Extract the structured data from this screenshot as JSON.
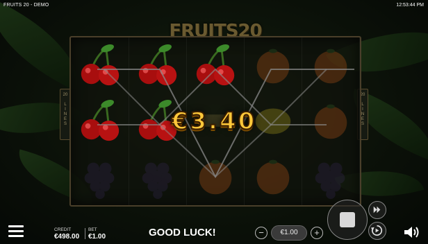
{
  "topbar": {
    "title": "FRUITS 20 - DEMO",
    "clock": "12:53:44 PM"
  },
  "logo": {
    "text": "FRUITS20"
  },
  "lines_badge": {
    "count": "20",
    "label": "LINES"
  },
  "reels": [
    [
      "cherry",
      "cherry",
      "grapes"
    ],
    [
      "cherry",
      "cherry",
      "grapes"
    ],
    [
      "cherry",
      "bar",
      "orange"
    ],
    [
      "orange",
      "lemon",
      "orange"
    ],
    [
      "orange",
      "orange",
      "grapes"
    ]
  ],
  "win_amount": "€3.40",
  "footer": {
    "credit_label": "CREDIT",
    "credit_value": "€498.00",
    "bet_label": "BET",
    "bet_value": "€1.00",
    "message": "GOOD LUCK!",
    "bet_amount": "€1.00",
    "minus_label": "−",
    "plus_label": "+"
  },
  "icons": {
    "menu": "hamburger-menu-icon",
    "turbo": "fast-forward-icon",
    "autoplay": "autoplay-icon",
    "stop": "stop-icon",
    "sound": "speaker-icon"
  },
  "colors": {
    "win_gold": "#ffc83a",
    "cherry_red": "#b01010",
    "frame_brown": "#4a3f2a"
  }
}
